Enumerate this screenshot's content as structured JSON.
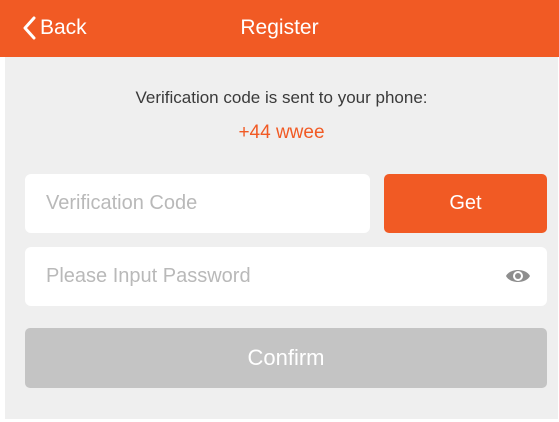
{
  "header": {
    "back_label": "Back",
    "title": "Register",
    "back_icon": "chevron-left-icon"
  },
  "info": {
    "message": "Verification code is sent to your phone:",
    "phone": "+44 wwee"
  },
  "verification": {
    "value": "",
    "placeholder": "Verification Code",
    "get_label": "Get"
  },
  "password": {
    "value": "",
    "placeholder": "Please Input Password",
    "toggle_icon": "eye-icon"
  },
  "confirm": {
    "label": "Confirm",
    "enabled": false
  },
  "colors": {
    "accent": "#f15a24",
    "background": "#efefef",
    "disabled_button": "#c4c4c4"
  }
}
